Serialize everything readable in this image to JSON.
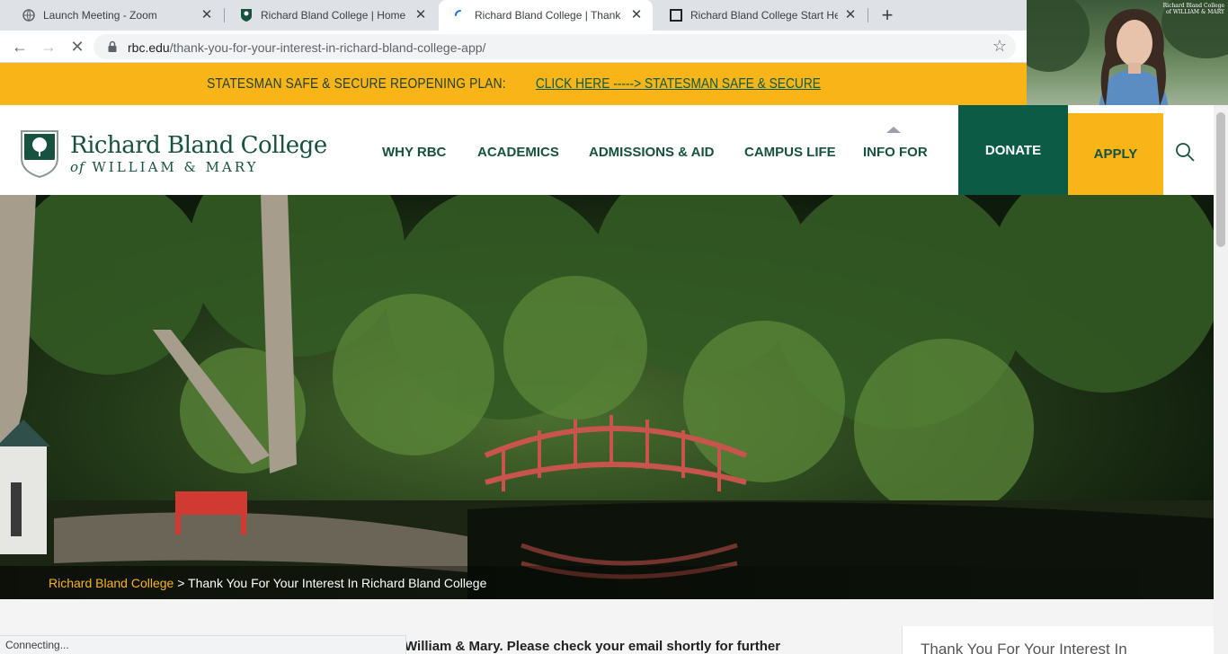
{
  "browser": {
    "tabs": [
      {
        "title": "Launch Meeting - Zoom",
        "favicon": "globe-icon",
        "active": false
      },
      {
        "title": "Richard Bland College | Home Pa",
        "favicon": "rbc-shield-icon",
        "active": false
      },
      {
        "title": "Richard Bland College | Thank Yo",
        "favicon": "loading-spinner-icon",
        "active": true
      },
      {
        "title": "Richard Bland College Start Here",
        "favicon": "page-icon",
        "active": false
      }
    ],
    "url_host": "rbc.edu",
    "url_path": "/thank-you-for-your-interest-in-richard-bland-college-app/",
    "status": "Connecting..."
  },
  "video": {
    "caption_line1": "Richard Bland College",
    "caption_line2": "of WILLIAM & MARY"
  },
  "alert": {
    "label": "STATESMAN SAFE & SECURE REOPENING PLAN:",
    "link": "CLICK HERE -----> STATESMAN SAFE & SECURE"
  },
  "header": {
    "logo_name": "Richard Bland College",
    "logo_of": "of",
    "logo_sub": "WILLIAM & MARY",
    "menu": [
      "WHY RBC",
      "ACADEMICS",
      "ADMISSIONS & AID",
      "CAMPUS LIFE",
      "INFO FOR"
    ],
    "donate": "DONATE",
    "apply": "APPLY"
  },
  "breadcrumb": {
    "home": "Richard Bland College",
    "separator": ">",
    "current": "Thank You For Your Interest In Richard Bland College"
  },
  "content": {
    "main_text": "William & Mary. Please check your email shortly for further",
    "sidebar_title": "Thank You For Your Interest In"
  },
  "colors": {
    "brand_green": "#17513f",
    "donate_green": "#0b5b45",
    "gold": "#f9b418"
  }
}
